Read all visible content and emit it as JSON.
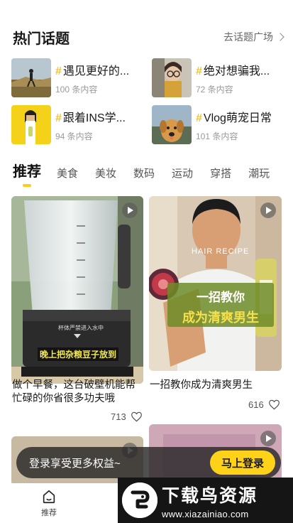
{
  "header": {
    "title": "热门话题",
    "link": "去话题广场"
  },
  "topics": [
    {
      "title": "遇见更好的...",
      "count": "100 条内容"
    },
    {
      "title": "绝对想骗我...",
      "count": "72 条内容"
    },
    {
      "title": "跟着INS学...",
      "count": "94 条内容"
    },
    {
      "title": "Vlog萌宠日常",
      "count": "101 条内容"
    }
  ],
  "tabs": [
    "推荐",
    "美食",
    "美妆",
    "数码",
    "运动",
    "穿搭",
    "潮玩"
  ],
  "cards": [
    {
      "subtitle": "晚上把杂粮豆子放到",
      "blender_hint": "杯体严禁进入水中",
      "title": "做个早餐，这台破壁机能帮忙碌的你省很多功夫哦",
      "likes": "713"
    },
    {
      "overlay_brand": "HAIR RECIPE",
      "overlay_line1": "一招教你",
      "overlay_line2": "成为清爽男生",
      "title": "一招教你成为清爽男生",
      "likes": "616"
    }
  ],
  "login_bar": {
    "text": "登录享受更多权益~",
    "button": "马上登录"
  },
  "bottom_nav": {
    "home": "推荐"
  },
  "watermark": {
    "cn": "下载鸟资源",
    "url": "www.xiazainiao.com"
  },
  "colors": {
    "accent": "#ffcc1a",
    "login_button": "#ffd21a",
    "text": "#1a1a1a"
  }
}
